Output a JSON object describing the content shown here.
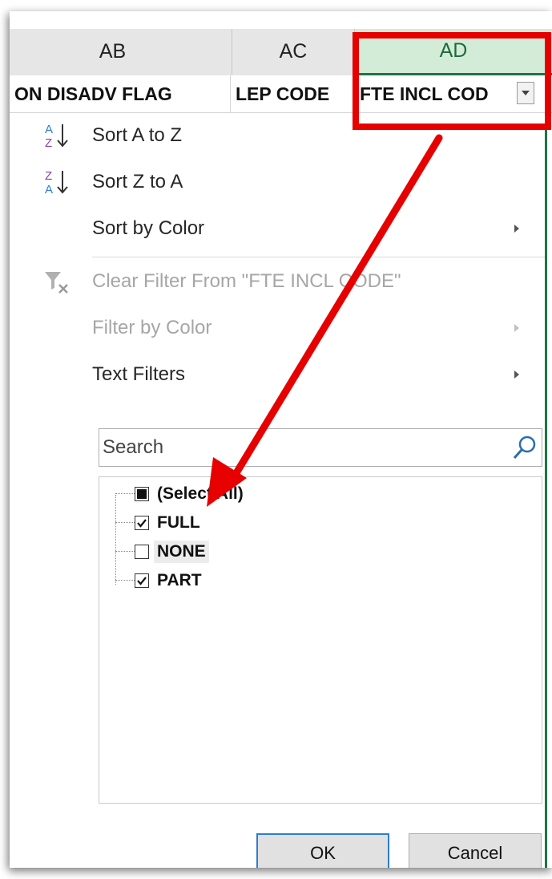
{
  "columns": [
    {
      "letter": "AB",
      "field": "ON DISADV FLAG"
    },
    {
      "letter": "AC",
      "field": "LEP CODE"
    },
    {
      "letter": "AD",
      "field": "FTE INCL COD"
    }
  ],
  "menu": {
    "sort_az": "Sort A to Z",
    "sort_za": "Sort Z to A",
    "sort_by_color": "Sort by Color",
    "clear_filter": "Clear Filter From \"FTE INCL CODE\"",
    "filter_by_color": "Filter by Color",
    "text_filters": "Text Filters"
  },
  "search": {
    "placeholder": "Search"
  },
  "filter_list": [
    {
      "label": "(Select All)",
      "state": "partial"
    },
    {
      "label": "FULL",
      "state": "checked"
    },
    {
      "label": "NONE",
      "state": "unchecked"
    },
    {
      "label": "PART",
      "state": "checked"
    }
  ],
  "buttons": {
    "ok": "OK",
    "cancel": "Cancel"
  },
  "colors": {
    "annotation": "#e60000",
    "selected_header_bg": "#d3ecd8",
    "excel_green": "#217346",
    "ok_border": "#2b7cd3"
  }
}
